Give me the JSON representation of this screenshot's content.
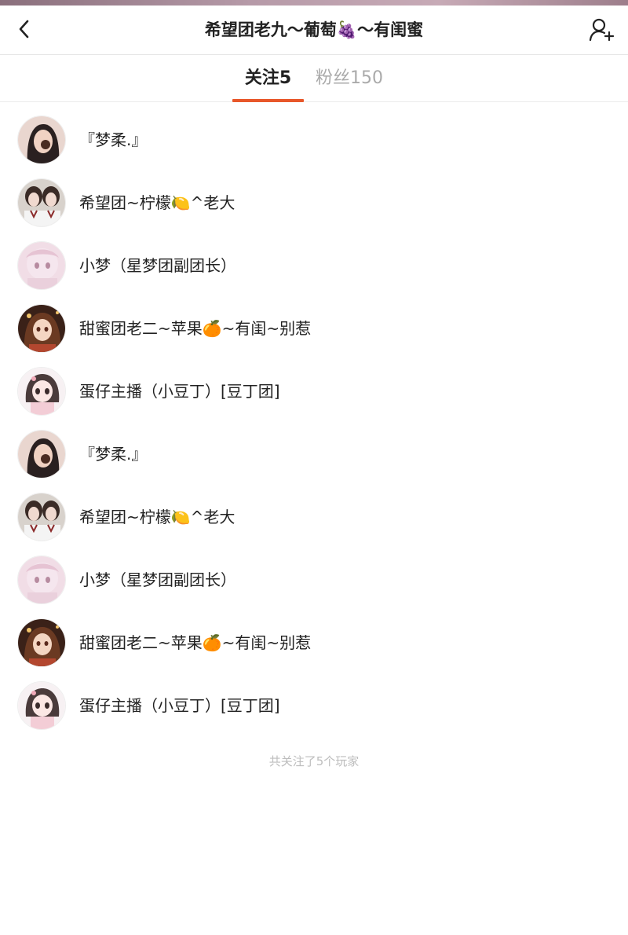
{
  "header": {
    "title": "希望团老九～葡萄🍇～有闺蜜",
    "back_icon": "chevron-left-icon",
    "add_icon": "add-user-icon"
  },
  "tabs": {
    "following_label": "关注",
    "following_count": "5",
    "followers_label": "粉丝",
    "followers_count": "150",
    "active": "following",
    "accent_color": "#e8572a"
  },
  "users": [
    {
      "name": "『梦柔.』",
      "avatar": "girl-dark-hair-avatar"
    },
    {
      "name": "希望团~柠檬🍋^老大",
      "avatar": "two-girls-avatar"
    },
    {
      "name": "小梦（星梦团副团长）",
      "avatar": "pink-anime-avatar"
    },
    {
      "name": "甜蜜团老二~苹果🍊~有闺~别惹",
      "avatar": "brown-hair-anime-avatar"
    },
    {
      "name": "蛋仔主播（小豆丁）[豆丁团]",
      "avatar": "chibi-girl-avatar"
    },
    {
      "name": "『梦柔.』",
      "avatar": "girl-dark-hair-avatar"
    },
    {
      "name": "希望团~柠檬🍋^老大",
      "avatar": "two-girls-avatar"
    },
    {
      "name": "小梦（星梦团副团长）",
      "avatar": "pink-anime-avatar"
    },
    {
      "name": "甜蜜团老二~苹果🍊~有闺~别惹",
      "avatar": "brown-hair-anime-avatar"
    },
    {
      "name": "蛋仔主播（小豆丁）[豆丁团]",
      "avatar": "chibi-girl-avatar"
    }
  ],
  "footer_note": "共关注了5个玩家"
}
